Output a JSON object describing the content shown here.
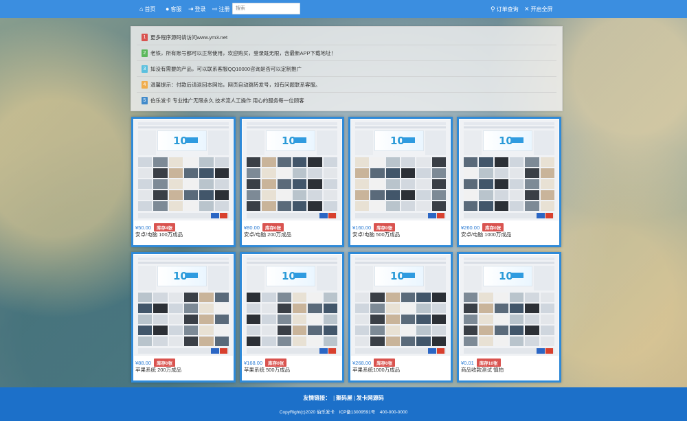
{
  "nav": {
    "home": "首页",
    "service": "客服",
    "login": "登录",
    "register": "注册",
    "search_placeholder": "搜索",
    "order_query": "订单查询",
    "fullscreen": "开启全屏"
  },
  "notices": [
    {
      "num": "1",
      "color": "#d9534f",
      "text": "更多程序源码请访问www.ym3.net"
    },
    {
      "num": "2",
      "color": "#5cb85c",
      "text": "老铁，所有账号都可以正常使用，欢迎购买，登录既无限，含最新APP下载地址！"
    },
    {
      "num": "3",
      "color": "#5bc0de",
      "text": "如没有需要的产品，可以联系客服QQ10000咨询是否可以定制推广"
    },
    {
      "num": "4",
      "color": "#f0ad4e",
      "text": "温馨提示：付款后请返回本网站，网页自动跳转发号，如有问题联系客服。"
    },
    {
      "num": "5",
      "color": "#428bca",
      "text": "伯乐发卡 专业推广无限永久 技术流人工操作 用心的服务每一位顾客"
    }
  ],
  "products": [
    {
      "price": "¥50.00",
      "stock": "库存4张",
      "name": "安卓/电脑 100万成品"
    },
    {
      "price": "¥80.00",
      "stock": "库存0张",
      "name": "安卓/电脑 200万成品"
    },
    {
      "price": "¥160.00",
      "stock": "库存0张",
      "name": "安卓/电脑 500万成品"
    },
    {
      "price": "¥260.00",
      "stock": "库存0张",
      "name": "安卓/电脑 1000万成品"
    },
    {
      "price": "¥88.00",
      "stock": "库存0张",
      "name": "苹果系统 200万成品"
    },
    {
      "price": "¥168.00",
      "stock": "库存0张",
      "name": "苹果系统 500万成品"
    },
    {
      "price": "¥268.00",
      "stock": "库存0张",
      "name": "苹果系统1000万成品"
    },
    {
      "price": "¥0.01",
      "stock": "库存10张",
      "name": "商品收款测试 慎拍"
    }
  ],
  "footer": {
    "friend_links_label": "友情链接：",
    "links": [
      "聚码屋",
      "发卡网源码"
    ],
    "copyright": "CopyRight(c)2020 伯乐发卡　ICP备13009591号　400-000-0000"
  },
  "colors": {
    "navbar": "#3b8ee0",
    "footer": "#1c70c9",
    "card_border": "#2f8ad8",
    "stock_badge": "#d9534f",
    "price": "#2b7bd3"
  }
}
